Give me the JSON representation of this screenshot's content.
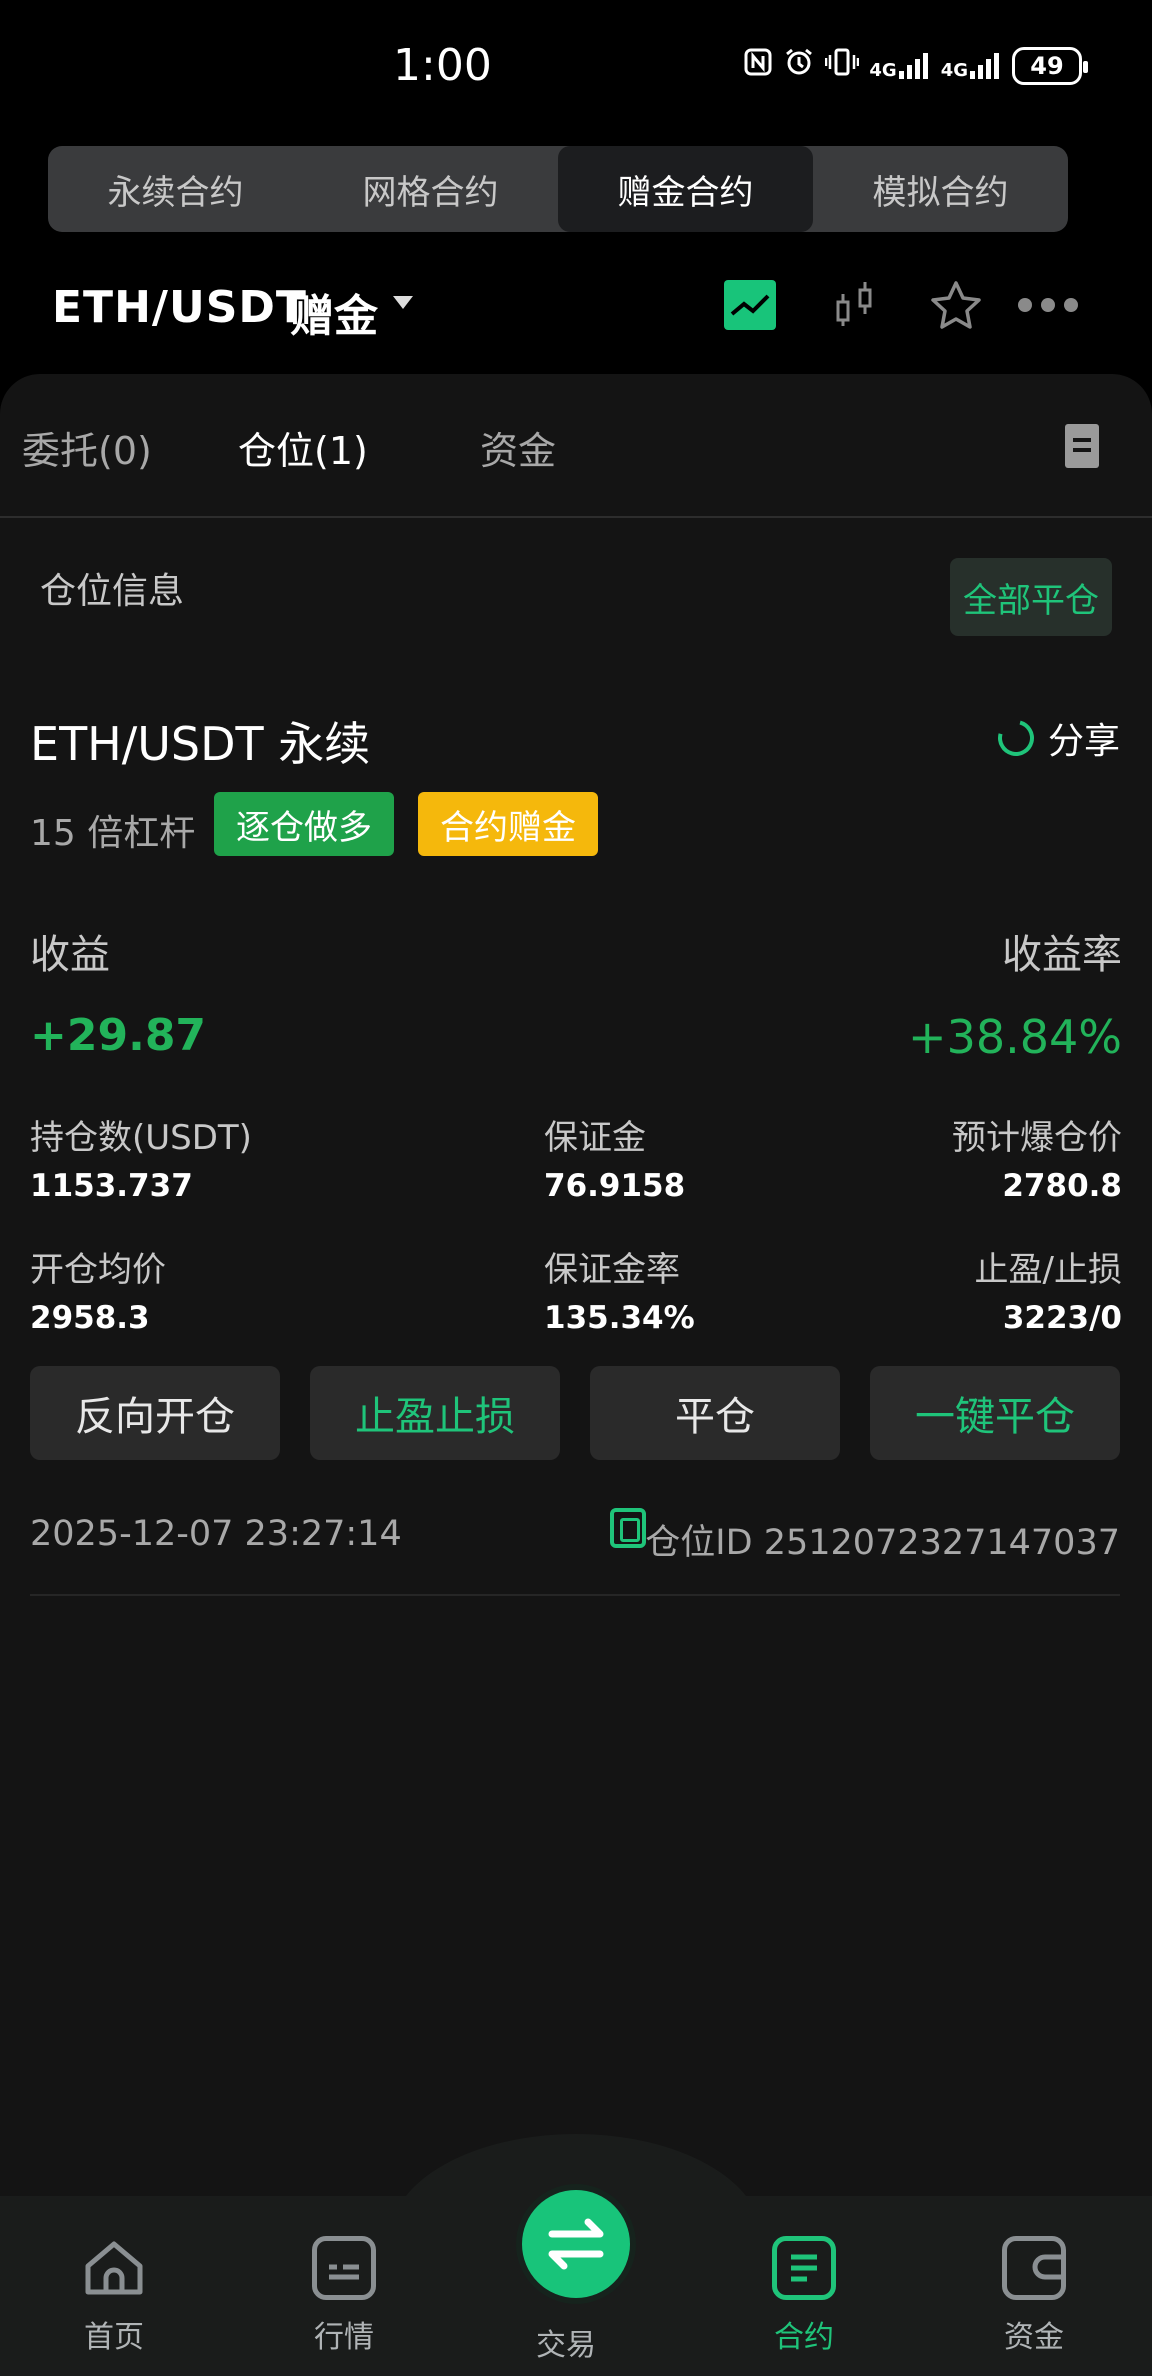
{
  "status_bar": {
    "time": "1:00",
    "icons": [
      "nfc-icon",
      "alarm-icon",
      "vibrate-icon",
      "4g-signal-icon",
      "4g-signal-icon"
    ],
    "signal_1": "4G",
    "signal_2": "4G",
    "battery": "49"
  },
  "contract_tabs": [
    {
      "label": "永续合约",
      "active": false
    },
    {
      "label": "网格合约",
      "active": false
    },
    {
      "label": "赠金合约",
      "active": true
    },
    {
      "label": "模拟合约",
      "active": false
    }
  ],
  "header": {
    "symbol": "ETH/USDT",
    "tag": "赠金"
  },
  "sub_tabs": {
    "orders": "委托(0)",
    "positions": "仓位(1)",
    "funds": "资金"
  },
  "position_section": {
    "title": "仓位信息",
    "close_all": "全部平仓"
  },
  "position": {
    "symbol": "ETH/USDT 永续",
    "share": "分享",
    "leverage": "15 倍杠杆",
    "badge_side": "逐仓做多",
    "badge_type": "合约赠金",
    "pnl_label": "收益",
    "pnl_rate_label": "收益率",
    "pnl": "+29.87",
    "pnl_rate": "+38.84%",
    "size_label": "持仓数(USDT)",
    "size": "1153.737",
    "margin_label": "保证金",
    "margin": "76.9158",
    "liq_label": "预计爆仓价",
    "liq_price": "2780.8",
    "entry_label": "开仓均价",
    "entry_price": "2958.3",
    "margin_rate_label": "保证金率",
    "margin_rate": "135.34%",
    "tpsl_label": "止盈/止损",
    "tpsl": "3223/0",
    "time": "2025-12-07 23:27:14",
    "position_id": "仓位ID 2512072327147037"
  },
  "actions": {
    "reverse": "反向开仓",
    "tpsl": "止盈止损",
    "close": "平仓",
    "quick_close": "一键平仓"
  },
  "bottom_nav": {
    "home": "首页",
    "market": "行情",
    "trade": "交易",
    "contract": "合约",
    "assets": "资金"
  },
  "colors": {
    "accent": "#1fc47a",
    "profit": "#22b35a",
    "bonus_badge": "#f5b80c",
    "long_badge": "#1fa24a"
  }
}
